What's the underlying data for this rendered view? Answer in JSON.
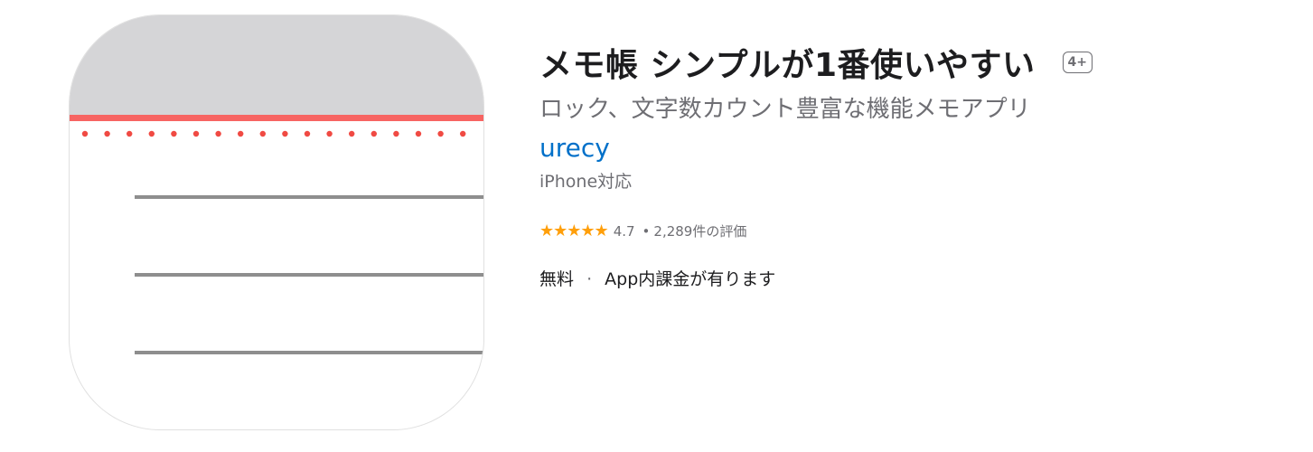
{
  "app": {
    "title": "メモ帳 シンプルが1番使いやすい",
    "age_rating": "4+",
    "subtitle": "ロック、文字数カウント豊富な機能メモアプリ",
    "developer": "urecy",
    "device_support": "iPhone対応",
    "rating": {
      "stars": 4.7,
      "value_text": "4.7",
      "bullet": "•",
      "count_text": "2,289件の評価"
    },
    "price": "無料",
    "price_separator": "·",
    "in_app_purchases": "App内課金が有ります"
  },
  "icon": {
    "name": "notepad-icon",
    "colors": {
      "header_gray": "#d5d5d7",
      "red_line": "#f76462",
      "dots": "#f04a43",
      "rules": "#8e8e8e"
    }
  },
  "colors": {
    "link_blue": "#0070c9",
    "star_orange": "#ff9f0a",
    "secondary_text": "#6e6e73"
  }
}
